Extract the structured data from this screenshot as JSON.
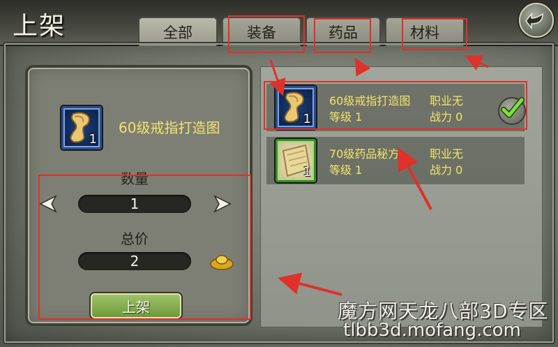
{
  "title": "上架",
  "tabs": [
    {
      "label": "全部"
    },
    {
      "label": "装备"
    },
    {
      "label": "药品"
    },
    {
      "label": "材料"
    }
  ],
  "selected_item": {
    "name": "60级戒指打造图",
    "count": "1"
  },
  "quantity": {
    "label": "数量",
    "value": "1"
  },
  "total_price": {
    "label": "总价",
    "value": "2"
  },
  "shelf_button": "上架",
  "inventory": [
    {
      "name": "60级戒指打造图",
      "job": "职业无",
      "level": "等级 1",
      "power": "战力 0",
      "count": "1",
      "selected": true,
      "icon": "ring-blueprint-scroll-icon"
    },
    {
      "name": "70级药品秘方",
      "job": "职业无",
      "level": "等级 1",
      "power": "战力 0",
      "count": "1",
      "selected": false,
      "icon": "medicine-recipe-scroll-icon"
    }
  ],
  "watermark": {
    "line1": "魔方网天龙八部3D专区",
    "line2": "tlbb3d.mofang.com"
  },
  "colors": {
    "accent_yellow": "#f3e46a",
    "annotation_red": "#e0302a",
    "button_green": "#7aa540"
  }
}
